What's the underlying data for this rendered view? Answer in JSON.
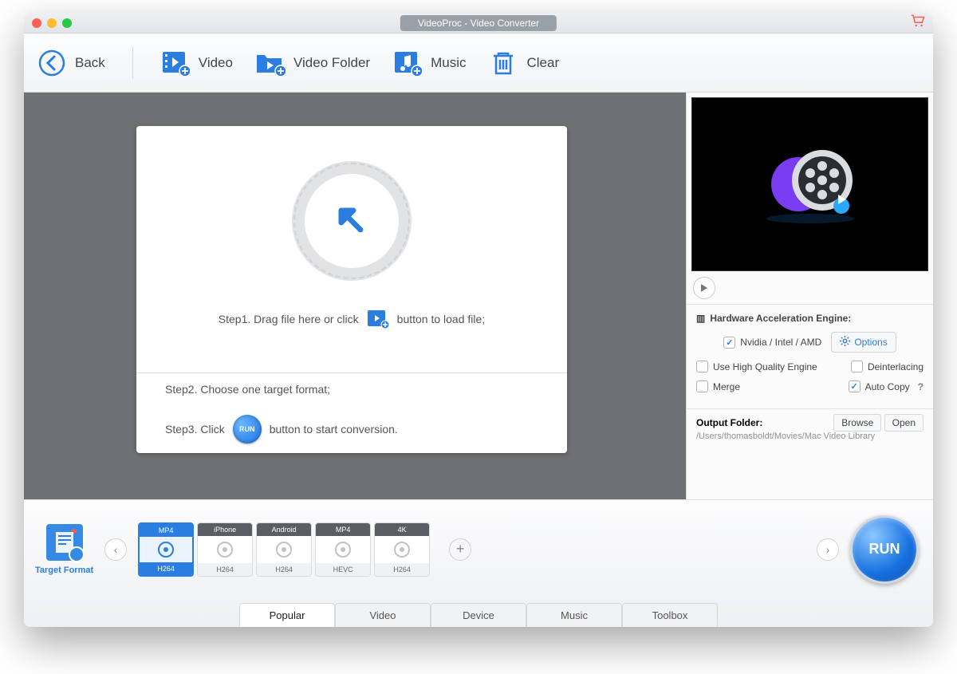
{
  "window": {
    "title": "VideoProc - Video Converter"
  },
  "toolbar": {
    "back": "Back",
    "video": "Video",
    "video_folder": "Video Folder",
    "music": "Music",
    "clear": "Clear"
  },
  "drop": {
    "step1a": "Step1. Drag file here or click",
    "step1b": "button to load file;",
    "step2": "Step2. Choose one target format;",
    "step3a": "Step3. Click",
    "step3b": "button to start conversion.",
    "run_mini": "RUN"
  },
  "sidebar": {
    "hw_title": "Hardware Acceleration Engine:",
    "nvidia": "Nvidia / Intel / AMD",
    "options": "Options",
    "hq": "Use High Quality Engine",
    "deinterlace": "Deinterlacing",
    "merge": "Merge",
    "autocopy": "Auto Copy",
    "output_folder_label": "Output Folder:",
    "browse": "Browse",
    "open": "Open",
    "output_path": "/Users/thomasboldt/Movies/Mac Video Library"
  },
  "footer": {
    "target_format": "Target Format",
    "presets": [
      {
        "top": "MP4",
        "bot": "H264",
        "active": true
      },
      {
        "top": "iPhone",
        "bot": "H264",
        "active": false
      },
      {
        "top": "Android",
        "bot": "H264",
        "active": false
      },
      {
        "top": "MP4",
        "bot": "HEVC",
        "active": false
      },
      {
        "top": "4K",
        "bot": "H264",
        "active": false
      }
    ],
    "tabs": [
      "Popular",
      "Video",
      "Device",
      "Music",
      "Toolbox"
    ],
    "active_tab": 0,
    "run": "RUN"
  }
}
